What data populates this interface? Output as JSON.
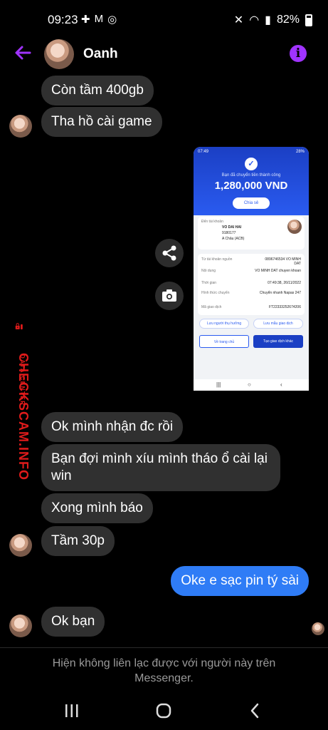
{
  "status": {
    "time": "09:23",
    "battery": "82%"
  },
  "header": {
    "contact_name": "Oanh"
  },
  "messages": {
    "m1": "Còn tầm 400gb",
    "m2": "Tha hồ cài game",
    "m3": "Ok mình nhận đc rồi",
    "m4": "Bạn đợi mình xíu mình tháo ổ cài lại win",
    "m5": "Xong mình báo",
    "m6": "Tầm 30p",
    "m7": "Oke e sạc pin tý sài",
    "m8": "Ok bạn"
  },
  "attachment": {
    "status_time": "07:49",
    "status_right": "28%",
    "sent_text": "Bạn đã chuyển tiền thành công",
    "amount": "1,280,000 VND",
    "share_label": "Chia sẻ",
    "to_account_label": "Đến tài khoản",
    "recipient": "VO DAI HAI",
    "account_no": "9180177",
    "bank": "A Châu (ACB)",
    "rows": [
      {
        "label": "Từ tài khoản nguồn",
        "value": "0896746534 VO MINH DAT"
      },
      {
        "label": "Nội dung",
        "value": "VO MINH DAT chuyen khoan"
      },
      {
        "label": "Thời gian",
        "value": "07:49:38, 26/11/2022"
      },
      {
        "label": "Hình thức chuyển",
        "value": "Chuyển nhanh Napas 247"
      },
      {
        "label": "Mã giao dịch",
        "value": "FT22333252674206"
      }
    ],
    "save_payee_label": "Lưu người thụ hưởng",
    "save_template_label": "Lưu mẫu giao dịch",
    "home_label": "Về trang chủ",
    "new_tx_label": "Tạo giao dịch khác"
  },
  "watermark": {
    "main": "CHECKSCAM.INFO",
    "sub": "DATA CENTER"
  },
  "footer": {
    "notice": "Hiện không liên lạc được với người này trên Messenger."
  },
  "icons": {
    "back": "arrow-left-icon",
    "info": "info-icon",
    "share": "share-icon",
    "camera": "camera-icon",
    "lock": "lock-icon"
  },
  "colors": {
    "accent": "#a033ff",
    "my_bubble": "#2f7cf6",
    "their_bubble": "#303030",
    "watermark": "#e01b1b",
    "bank_blue": "#2a5bf0"
  }
}
